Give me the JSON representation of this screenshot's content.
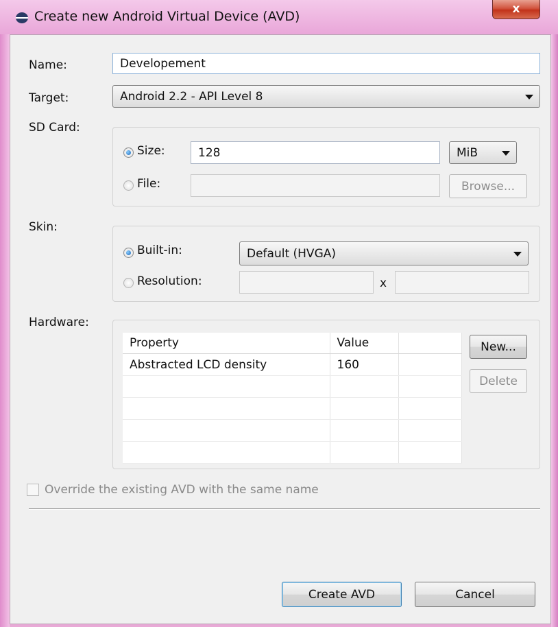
{
  "window": {
    "title": "Create new Android Virtual Device (AVD)",
    "close_label": "x",
    "frame_color": "#e8a9d6"
  },
  "name": {
    "label": "Name:",
    "value": "Developement"
  },
  "target": {
    "label": "Target:",
    "value": "Android 2.2 - API Level 8"
  },
  "sdcard": {
    "label": "SD Card:",
    "size_label": "Size:",
    "size_value": "128",
    "unit": "MiB",
    "file_label": "File:",
    "file_value": "",
    "browse_label": "Browse...",
    "selected": "size"
  },
  "skin": {
    "label": "Skin:",
    "builtin_label": "Built-in:",
    "builtin_value": "Default (HVGA)",
    "resolution_label": "Resolution:",
    "res_separator": "x",
    "selected": "builtin"
  },
  "hardware": {
    "label": "Hardware:",
    "columns": [
      "Property",
      "Value",
      ""
    ],
    "rows": [
      {
        "property": "Abstracted LCD density",
        "value": "160"
      }
    ],
    "new_label": "New...",
    "delete_label": "Delete"
  },
  "override": {
    "label": "Override the existing AVD with the same name",
    "checked": false
  },
  "buttons": {
    "create": "Create AVD",
    "cancel": "Cancel"
  }
}
